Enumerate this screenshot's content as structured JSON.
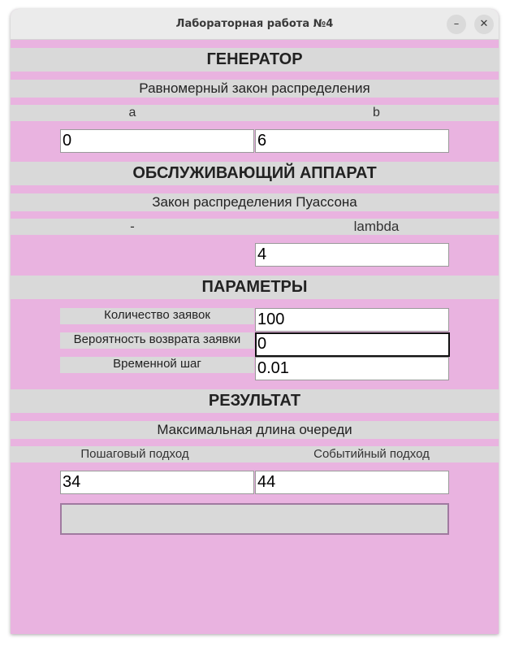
{
  "window": {
    "title": "Лабораторная работа №4",
    "minimize_glyph": "–",
    "close_glyph": "✕"
  },
  "generator": {
    "header": "ГЕНЕРАТОР",
    "distribution": "Равномерный закон распределения",
    "col_a": "a",
    "col_b": "b",
    "value_a": "0",
    "value_b": "6"
  },
  "server": {
    "header": "ОБСЛУЖИВАЮЩИЙ АППАРАТ",
    "distribution": "Закон распределения Пуассона",
    "col_left": "-",
    "col_right": "lambda",
    "value_lambda": "4"
  },
  "params": {
    "header": "ПАРАМЕТРЫ",
    "requests_label": "Количество заявок",
    "requests_value": "100",
    "return_prob_label": "Вероятность возврата заявки",
    "return_prob_value": "0",
    "time_step_label": "Временной шаг",
    "time_step_value": "0.01"
  },
  "result": {
    "header": "РЕЗУЛЬТАТ",
    "subtitle": "Максимальная длина очереди",
    "col_step": "Пошаговый подход",
    "col_event": "Событийный подход",
    "value_step": "34",
    "value_event": "44",
    "button_label": ""
  },
  "colors": {
    "background": "#e9b3e0",
    "band": "#d9d9d9"
  }
}
